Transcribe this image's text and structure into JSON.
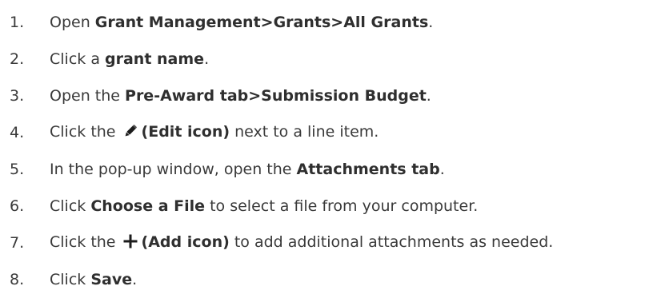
{
  "steps": [
    {
      "num": "1.",
      "parts": [
        {
          "t": "Open "
        },
        {
          "t": "Grant Management>Grants>All Grants",
          "b": true
        },
        {
          "t": "."
        }
      ]
    },
    {
      "num": "2.",
      "parts": [
        {
          "t": "Click a "
        },
        {
          "t": "grant name",
          "b": true
        },
        {
          "t": "."
        }
      ]
    },
    {
      "num": "3.",
      "parts": [
        {
          "t": "Open the "
        },
        {
          "t": "Pre-Award tab>Submission Budget",
          "b": true
        },
        {
          "t": "."
        }
      ]
    },
    {
      "num": "4.",
      "parts": [
        {
          "t": "Click the "
        },
        {
          "icon": "pencil-icon"
        },
        {
          "t": "(Edit icon)",
          "b": true
        },
        {
          "t": " next to a line item."
        }
      ]
    },
    {
      "num": "5.",
      "parts": [
        {
          "t": "In the pop-up window, open the "
        },
        {
          "t": "Attachments tab",
          "b": true
        },
        {
          "t": "."
        }
      ]
    },
    {
      "num": "6.",
      "parts": [
        {
          "t": "Click "
        },
        {
          "t": "Choose a File",
          "b": true
        },
        {
          "t": " to select a file from your computer."
        }
      ]
    },
    {
      "num": "7.",
      "parts": [
        {
          "t": "Click the "
        },
        {
          "icon": "plus-icon"
        },
        {
          "t": "(Add icon)",
          "b": true
        },
        {
          "t": " to add additional attachments as needed."
        }
      ]
    },
    {
      "num": "8.",
      "parts": [
        {
          "t": "Click "
        },
        {
          "t": "Save",
          "b": true
        },
        {
          "t": "."
        }
      ]
    }
  ]
}
